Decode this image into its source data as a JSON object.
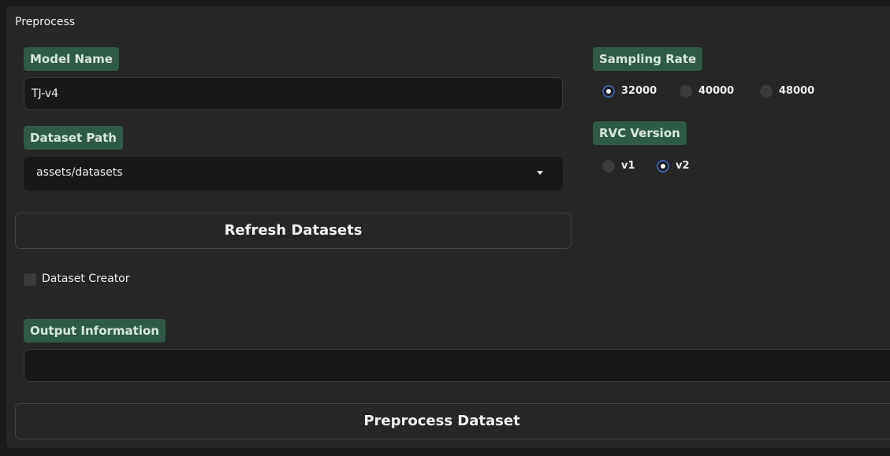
{
  "section_title": "Preprocess",
  "model_name": {
    "label": "Model Name",
    "value": "TJ-v4"
  },
  "dataset_path": {
    "label": "Dataset Path",
    "value": "assets/datasets"
  },
  "refresh_button": "Refresh Datasets",
  "dataset_creator": {
    "label": "Dataset Creator",
    "checked": false
  },
  "output_information": {
    "label": "Output Information",
    "value": ""
  },
  "preprocess_button": "Preprocess Dataset",
  "sampling_rate": {
    "label": "Sampling Rate",
    "options": [
      "32000",
      "40000",
      "48000"
    ],
    "selected": "32000"
  },
  "rvc_version": {
    "label": "RVC Version",
    "options": [
      "v1",
      "v2"
    ],
    "selected": "v2"
  },
  "colors": {
    "tag_background": "#2f5a47",
    "radio_selected": "#3f5fa6"
  }
}
